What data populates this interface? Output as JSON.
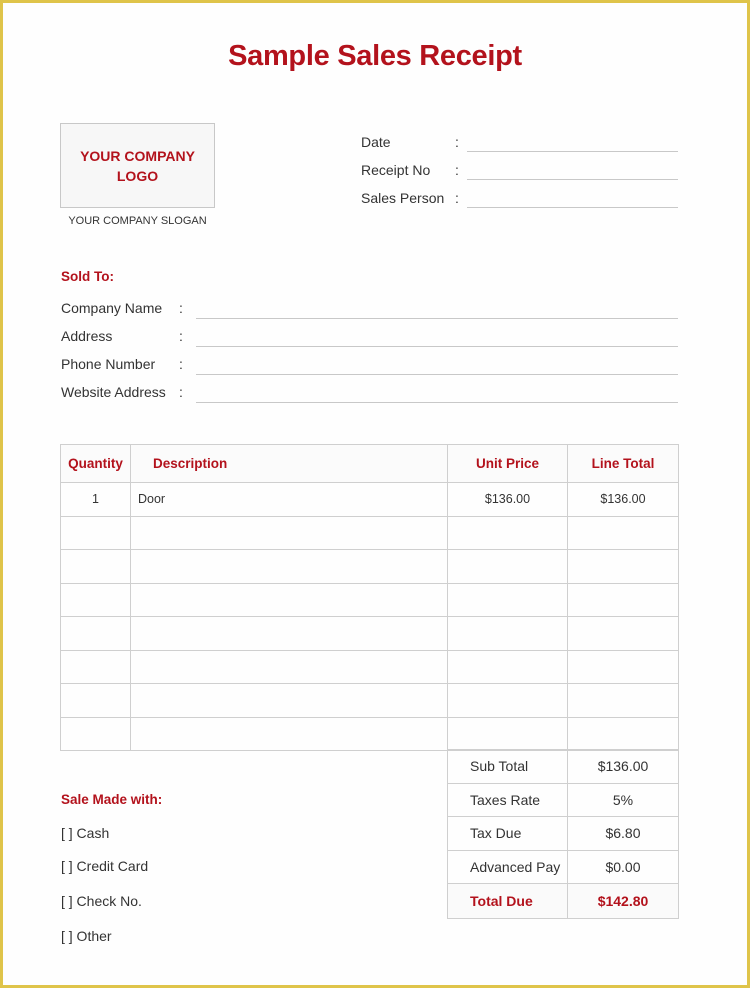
{
  "title": "Sample Sales Receipt",
  "company": {
    "logo_text": "YOUR COMPANY LOGO",
    "slogan": "YOUR COMPANY SLOGAN"
  },
  "receipt_info": [
    {
      "label": "Date",
      "colon": ":",
      "value": ""
    },
    {
      "label": "Receipt No",
      "colon": ":",
      "value": ""
    },
    {
      "label": "Sales Person",
      "colon": ":",
      "value": ""
    }
  ],
  "sold_to": {
    "heading": "Sold To:",
    "fields": [
      {
        "label": "Company Name",
        "colon": ":",
        "value": ""
      },
      {
        "label": "Address",
        "colon": ":",
        "value": ""
      },
      {
        "label": "Phone Number",
        "colon": ":",
        "value": ""
      },
      {
        "label": "Website Address",
        "colon": ":",
        "value": ""
      }
    ]
  },
  "items_table": {
    "headers": [
      "Quantity",
      "Description",
      "Unit Price",
      "Line Total"
    ],
    "rows": [
      [
        "1",
        "Door",
        "$136.00",
        "$136.00"
      ],
      [
        "",
        "",
        "",
        ""
      ],
      [
        "",
        "",
        "",
        ""
      ],
      [
        "",
        "",
        "",
        ""
      ],
      [
        "",
        "",
        "",
        ""
      ],
      [
        "",
        "",
        "",
        ""
      ],
      [
        "",
        "",
        "",
        ""
      ],
      [
        "",
        "",
        "",
        ""
      ]
    ]
  },
  "totals": [
    {
      "label": "Sub Total",
      "value": "$136.00"
    },
    {
      "label": "Taxes Rate",
      "value": "5%"
    },
    {
      "label": "Tax Due",
      "value": "$6.80"
    },
    {
      "label": "Advanced Pay",
      "value": "$0.00"
    },
    {
      "label": "Total Due",
      "value": "$142.80"
    }
  ],
  "payment": {
    "heading": "Sale Made with:",
    "options": [
      "[ ] Cash",
      "[ ] Credit Card",
      "[ ] Check No.",
      "[ ] Other"
    ]
  },
  "colors": {
    "accent": "#b3121c",
    "frame": "#dfc44a",
    "grid": "#cfcfcf"
  }
}
